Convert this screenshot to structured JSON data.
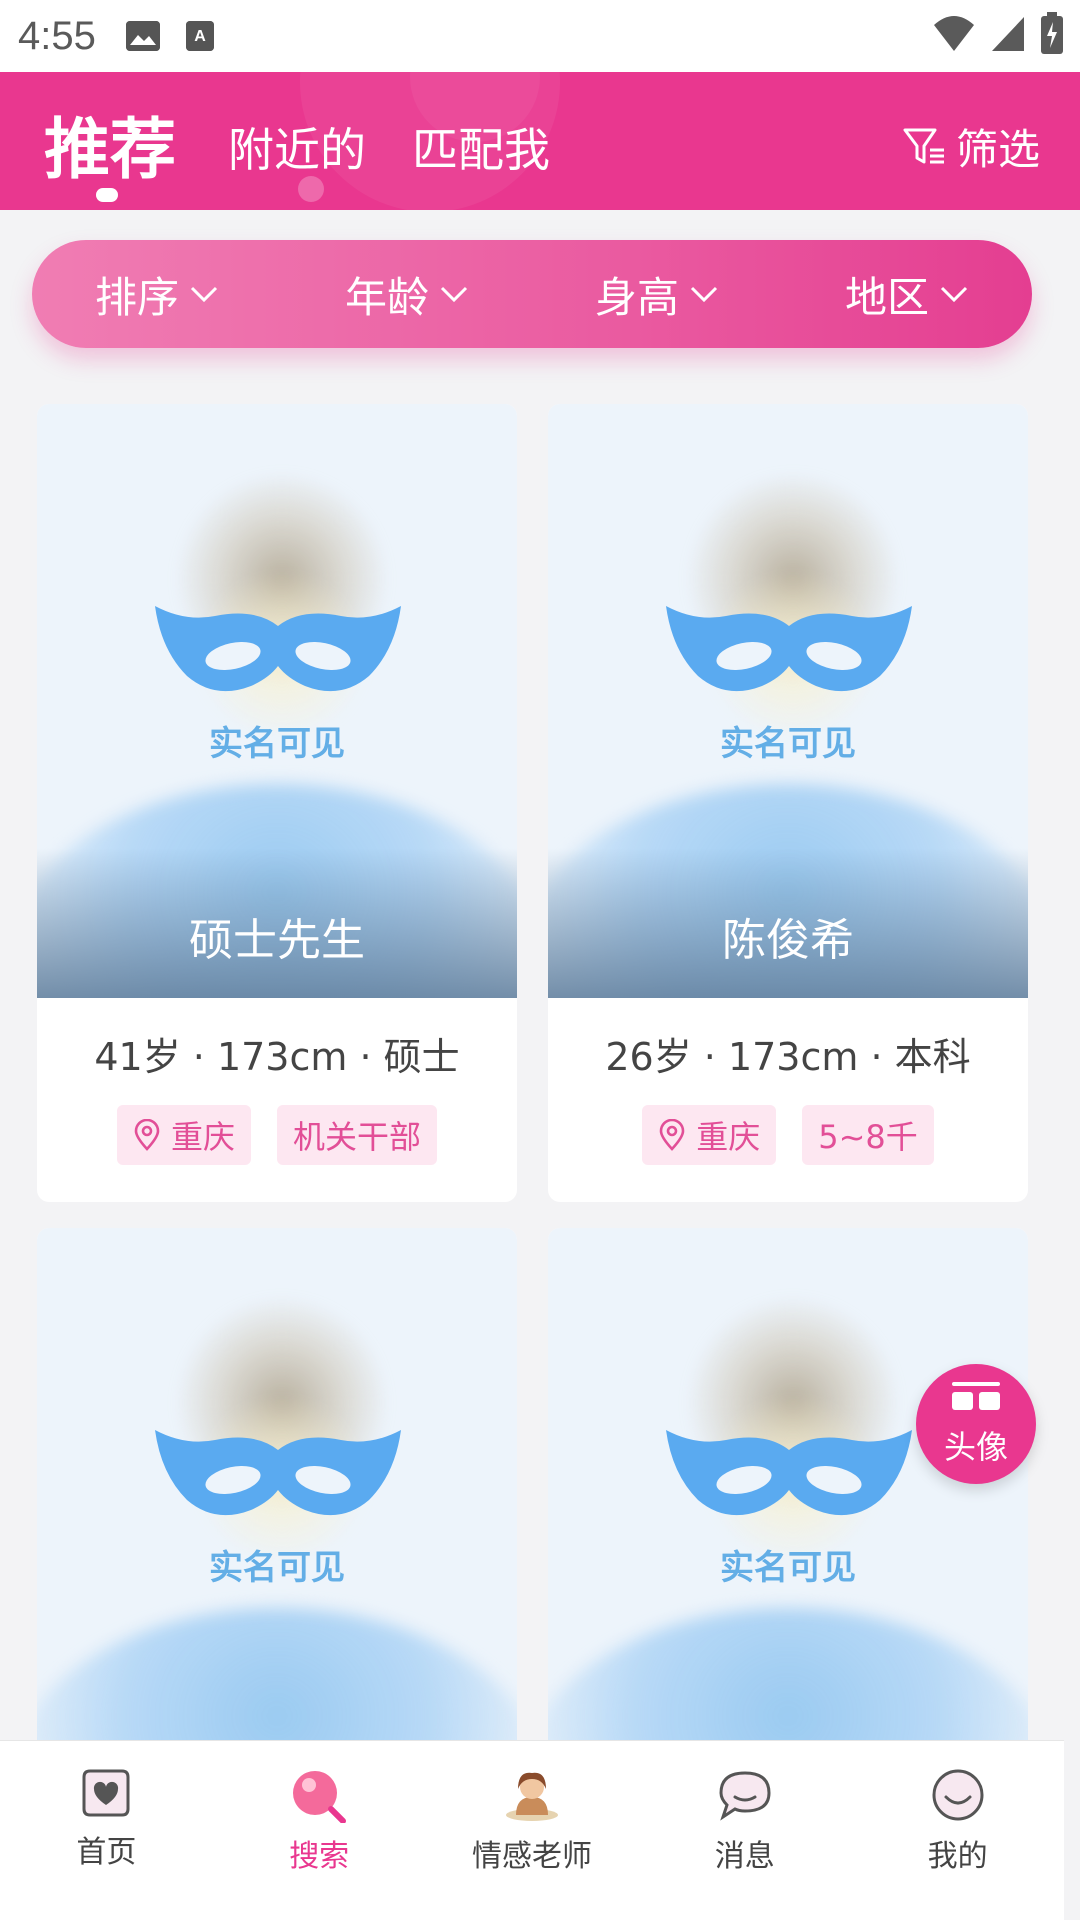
{
  "status_bar": {
    "time": "4:55"
  },
  "header": {
    "tabs": [
      {
        "label": "推荐",
        "active": true
      },
      {
        "label": "附近的",
        "active": false
      },
      {
        "label": "匹配我",
        "active": false
      }
    ],
    "filter_label": "筛选",
    "accent_color": "#e9378f"
  },
  "sort_bar": {
    "items": [
      {
        "label": "排序"
      },
      {
        "label": "年龄"
      },
      {
        "label": "身高"
      },
      {
        "label": "地区"
      }
    ]
  },
  "cards": [
    {
      "name": "硕士先生",
      "verify": "实名可见",
      "info": "41岁 · 173cm · 硕士",
      "location": "重庆",
      "tag2": "机关干部"
    },
    {
      "name": "陈俊希",
      "verify": "实名可见",
      "info": "26岁 · 173cm · 本科",
      "location": "重庆",
      "tag2": "5~8千"
    },
    {
      "name": "",
      "verify": "实名可见",
      "info": "",
      "location": "",
      "tag2": ""
    },
    {
      "name": "",
      "verify": "实名可见",
      "info": "",
      "location": "",
      "tag2": ""
    }
  ],
  "fab": {
    "label": "头像"
  },
  "bottom_nav": {
    "items": [
      {
        "label": "首页",
        "icon": "home-heart-icon"
      },
      {
        "label": "搜索",
        "icon": "search-icon",
        "active": true
      },
      {
        "label": "情感老师",
        "icon": "teacher-avatar-icon"
      },
      {
        "label": "消息",
        "icon": "chat-bubble-icon"
      },
      {
        "label": "我的",
        "icon": "smile-icon"
      }
    ]
  }
}
